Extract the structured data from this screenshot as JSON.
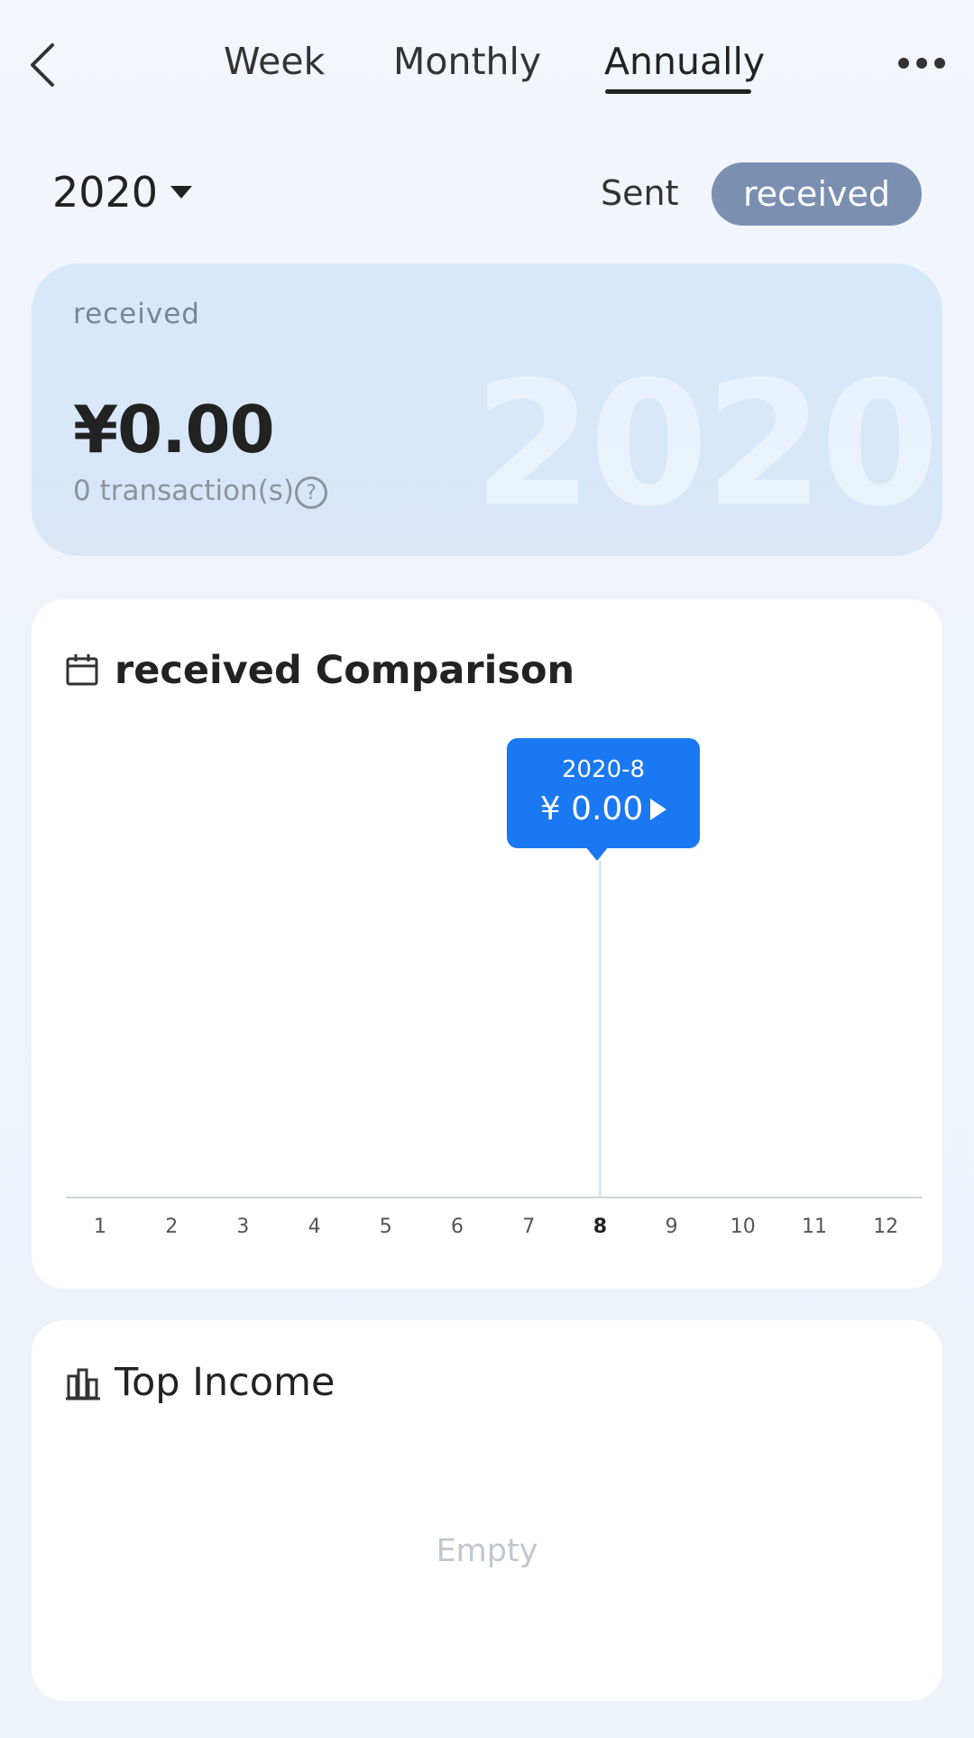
{
  "nav": {
    "tabs": [
      {
        "label": "Week"
      },
      {
        "label": "Monthly"
      },
      {
        "label": "Annually"
      }
    ],
    "active_tab": "Annually",
    "back_icon": "chevron-left-icon",
    "more_icon": "more-horizontal-icon"
  },
  "filter": {
    "year": "2020",
    "sent_label": "Sent",
    "received_label": "received",
    "active": "received"
  },
  "summary": {
    "label": "received",
    "amount": "¥0.00",
    "transactions": "0 transaction(s)",
    "watermark_year": "2020",
    "help_icon": "question-circle-icon"
  },
  "comparison": {
    "title": "received Comparison",
    "icon": "calendar-icon",
    "tooltip": {
      "date": "2020-8",
      "amount": "¥ 0.00"
    }
  },
  "chart_data": {
    "type": "bar",
    "categories": [
      "1",
      "2",
      "3",
      "4",
      "5",
      "6",
      "7",
      "8",
      "9",
      "10",
      "11",
      "12"
    ],
    "values": [
      0,
      0,
      0,
      0,
      0,
      0,
      0,
      0,
      0,
      0,
      0,
      0
    ],
    "selected_category": "8",
    "title": "received Comparison",
    "xlabel": "",
    "ylabel": "",
    "grid": false
  },
  "income": {
    "title": "Top Income",
    "icon": "bar-chart-icon",
    "empty_text": "Empty"
  },
  "colors": {
    "accent": "#1a78f2",
    "toggle_active": "#7b8fb0",
    "card_summary": "#d7e8fb"
  }
}
